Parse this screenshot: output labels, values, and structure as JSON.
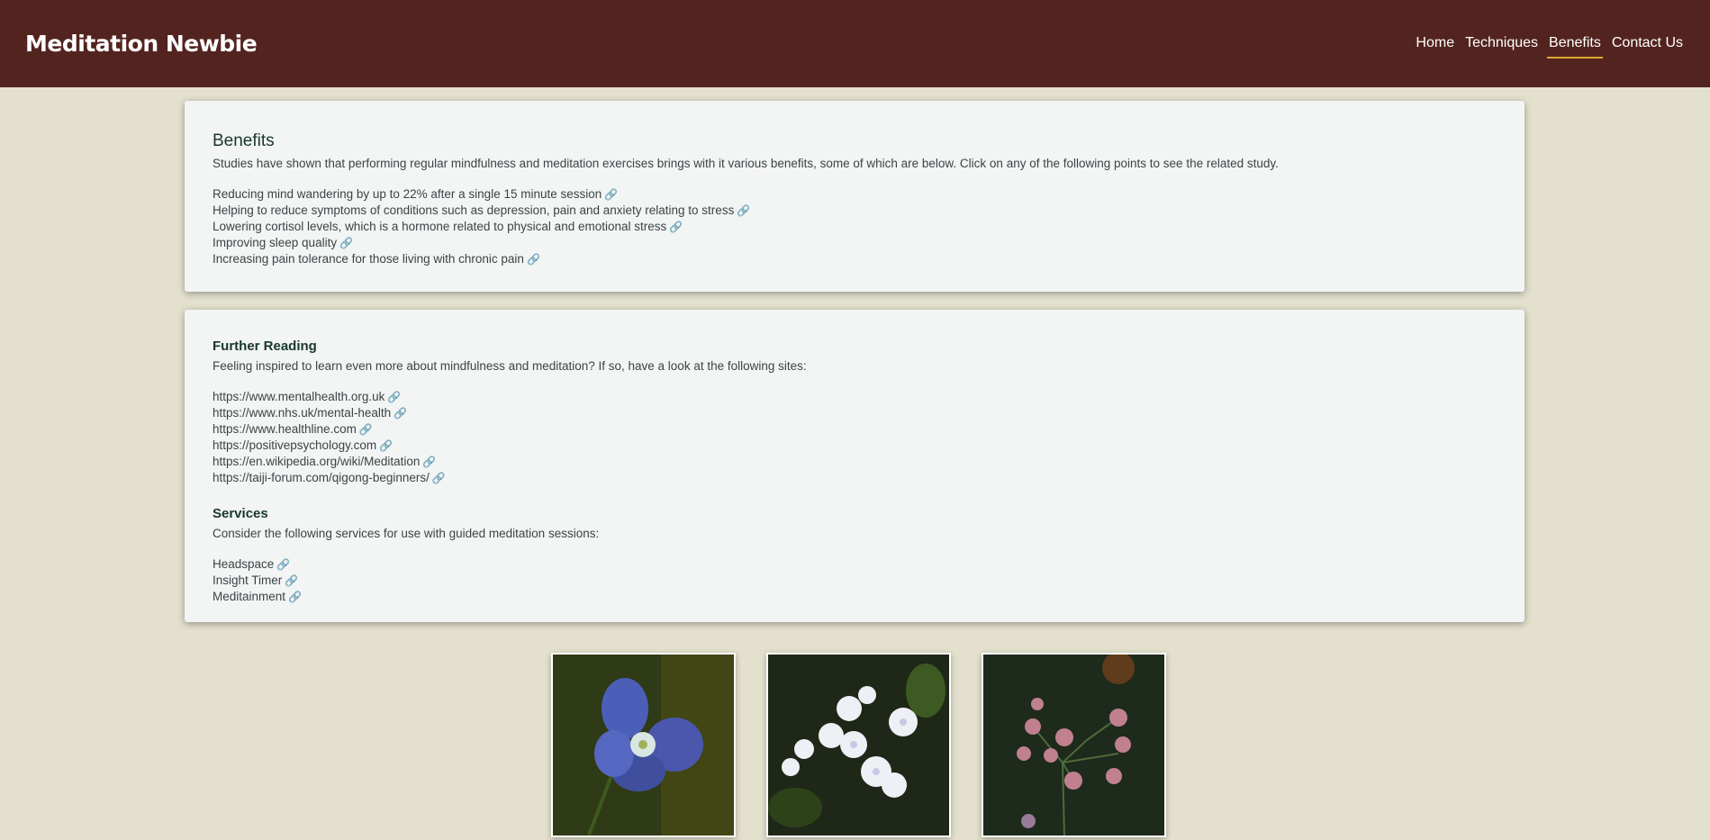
{
  "header": {
    "logo": "Meditation Newbie",
    "nav": [
      {
        "label": "Home"
      },
      {
        "label": "Techniques"
      },
      {
        "label": "Benefits"
      },
      {
        "label": "Contact Us"
      }
    ]
  },
  "benefits": {
    "title": "Benefits",
    "intro": "Studies have shown that performing regular mindfulness and meditation exercises brings with it various benefits, some of which are below. Click on any of the following points to see the related study.",
    "items": [
      "Reducing mind wandering by up to 22% after a single 15 minute session",
      "Helping to reduce symptoms of conditions such as depression, pain and anxiety relating to stress",
      "Lowering cortisol levels, which is a hormone related to physical and emotional stress",
      "Improving sleep quality",
      "Increasing pain tolerance for those living with chronic pain"
    ]
  },
  "further_reading": {
    "title": "Further Reading",
    "intro": "Feeling inspired to learn even more about mindfulness and meditation? If so, have a look at the following sites:",
    "links": [
      "https://www.mentalhealth.org.uk",
      "https://www.nhs.uk/mental-health",
      "https://www.healthline.com",
      "https://positivepsychology.com",
      "https://en.wikipedia.org/wiki/Meditation",
      "https://taiji-forum.com/qigong-beginners/"
    ]
  },
  "services": {
    "title": "Services",
    "intro": "Consider the following services for use with guided meditation sessions:",
    "items": [
      "Headspace",
      "Insight Timer",
      "Meditainment"
    ]
  },
  "colors": {
    "header_bg": "#53241f",
    "page_bg": "#e3e0cd",
    "card_bg": "#f3f4f4",
    "accent_underline": "#e0a82e",
    "heading": "#17372f"
  },
  "icons": {
    "link": "link-icon"
  }
}
